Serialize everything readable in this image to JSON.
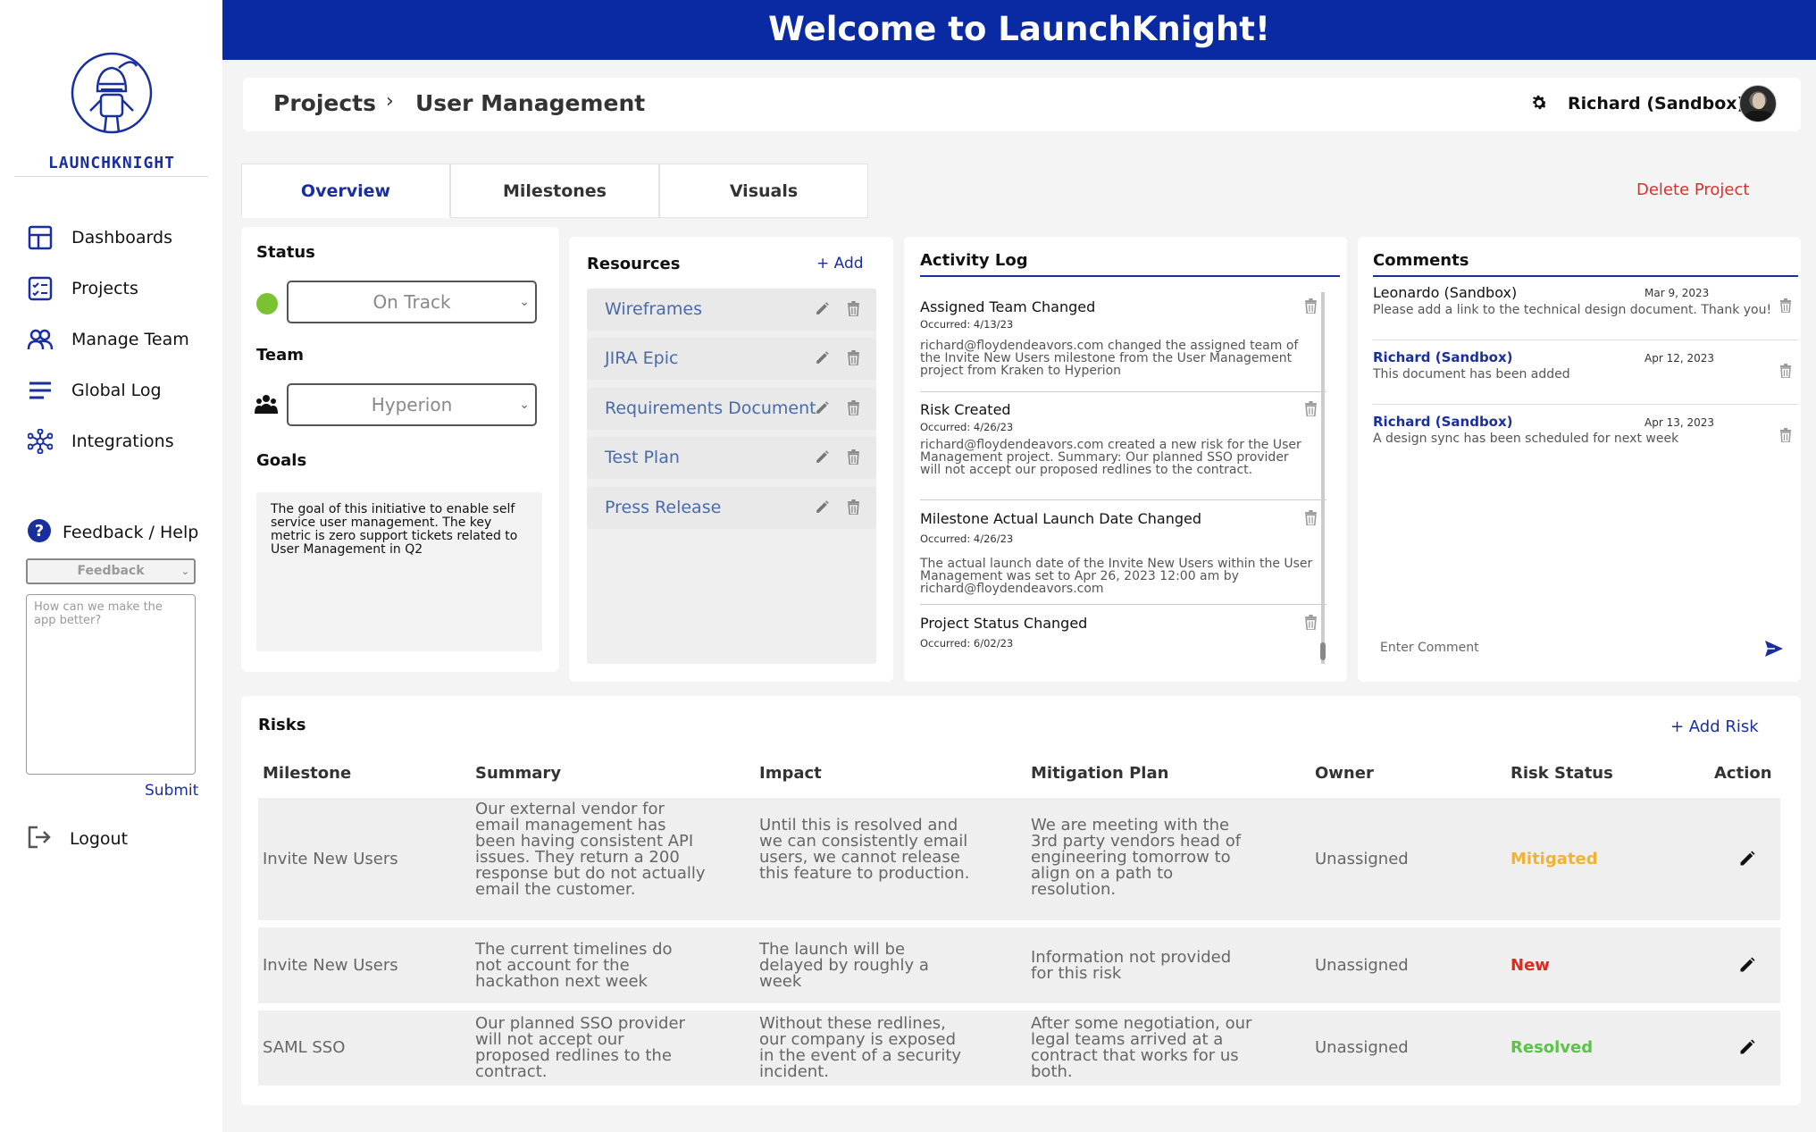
{
  "brand": {
    "name": "LAUNCHKNIGHT",
    "header_title": "Welcome to LaunchKnight!"
  },
  "sidebar": {
    "items": [
      {
        "label": "Dashboards",
        "icon": "dashboard-icon"
      },
      {
        "label": "Projects",
        "icon": "checklist-icon"
      },
      {
        "label": "Manage Team",
        "icon": "team-icon"
      },
      {
        "label": "Global Log",
        "icon": "list-lines-icon"
      },
      {
        "label": "Integrations",
        "icon": "network-icon"
      }
    ],
    "feedback": {
      "label": "Feedback / Help",
      "select_value": "Feedback",
      "placeholder": "How can we make the app better?",
      "submit": "Submit"
    },
    "logout": "Logout"
  },
  "breadcrumb": {
    "root": "Projects",
    "separator": "›",
    "current": "User Management"
  },
  "user": {
    "name": "Richard (Sandbox)"
  },
  "tabs": [
    {
      "label": "Overview",
      "active": true
    },
    {
      "label": "Milestones",
      "active": false
    },
    {
      "label": "Visuals",
      "active": false
    }
  ],
  "delete_project": "Delete Project",
  "status_card": {
    "status_label": "Status",
    "status_value": "On Track",
    "status_color": "#7ac231",
    "team_label": "Team",
    "team_value": "Hyperion",
    "goals_label": "Goals",
    "goals_text": "The goal of this initiative to enable self service user management. The key metric is zero support tickets related to User Management in Q2"
  },
  "resources": {
    "title": "Resources",
    "add": "+ Add",
    "items": [
      "Wireframes",
      "JIRA Epic",
      "Requirements Document",
      "Test Plan",
      "Press Release"
    ]
  },
  "activity": {
    "title": "Activity Log",
    "entries": [
      {
        "head": "Assigned Team Changed",
        "when": "Occurred:  4/13/23",
        "body": "richard@floydendeavors.com changed the assigned team of the Invite New Users milestone from the User Management project from Kraken to Hyperion"
      },
      {
        "head": "Risk Created",
        "when": "Occurred:  4/26/23",
        "body": "richard@floydendeavors.com created a new risk for the User Management project. Summary: Our planned SSO provider will not accept our proposed redlines to the contract."
      },
      {
        "head": "Milestone Actual Launch Date Changed",
        "when": "Occurred:  4/26/23",
        "body": "The actual launch date of the Invite New Users within the User Management was set to Apr 26, 2023 12:00 am by  richard@floydendeavors.com"
      },
      {
        "head": "Project Status Changed",
        "when": "Occurred:  6/02/23",
        "body": ""
      }
    ]
  },
  "comments": {
    "title": "Comments",
    "items": [
      {
        "author": "Leonardo (Sandbox)",
        "date": "Mar 9, 2023",
        "text": "Please add a link to the technical design document. Thank you!"
      },
      {
        "author": "Richard (Sandbox)",
        "date": "Apr 12, 2023",
        "text": "This document has been added"
      },
      {
        "author": "Richard (Sandbox)",
        "date": "Apr 13, 2023",
        "text": "A design sync has been scheduled for next week"
      }
    ],
    "input_placeholder": "Enter Comment"
  },
  "risks": {
    "title": "Risks",
    "add": "+ Add Risk",
    "columns": [
      "Milestone",
      "Summary",
      "Impact",
      "Mitigation Plan",
      "Owner",
      "Risk Status",
      "Action"
    ],
    "rows": [
      {
        "milestone": "Invite New Users",
        "summary": "Our external vendor for email management has been having consistent API issues. They return a 200 response but do not actually email the customer.",
        "impact": "Until this is resolved and we can consistently email users, we cannot release this feature to production.",
        "mitigation": "We are meeting with the 3rd party vendors head of engineering tomorrow to align on a path to resolution.",
        "owner": "Unassigned",
        "status": "Mitigated",
        "status_color": "#f2b233"
      },
      {
        "milestone": "Invite New Users",
        "summary": "The current timelines do not account for the hackathon next week",
        "impact": "The launch will be delayed by roughly a week",
        "mitigation": "Information not provided for this risk",
        "owner": "Unassigned",
        "status": "New",
        "status_color": "#e0281c"
      },
      {
        "milestone": "SAML SSO",
        "summary": "Our planned SSO provider will not accept our proposed redlines to the contract.",
        "impact": "Without these redlines, our company is exposed in the event of a security incident.",
        "mitigation": "After some negotiation, our legal teams arrived at a contract that works for us both.",
        "owner": "Unassigned",
        "status": "Resolved",
        "status_color": "#5cc24a"
      }
    ]
  }
}
